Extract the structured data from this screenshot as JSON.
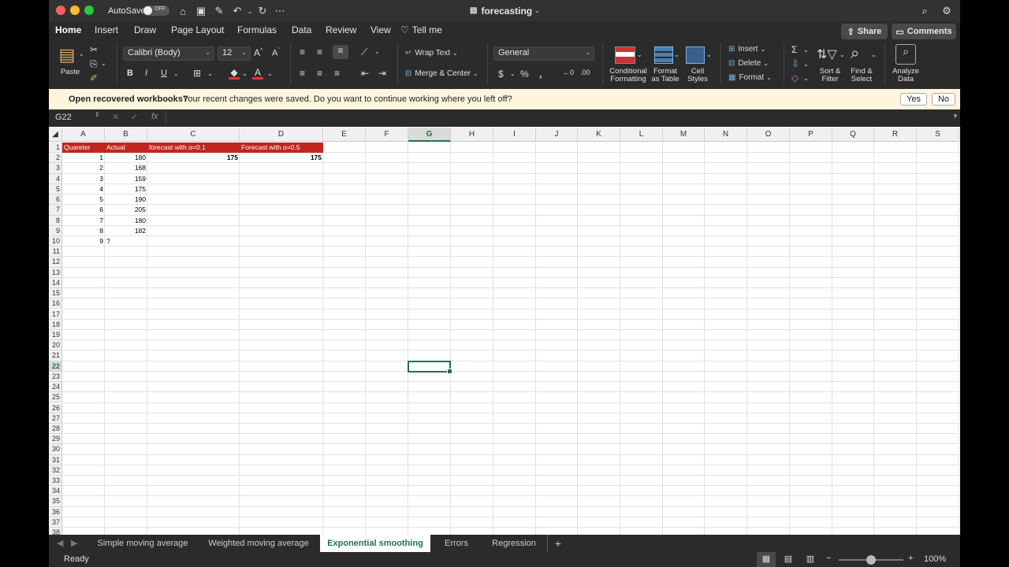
{
  "window": {
    "title": "forecasting",
    "autosave_label": "AutoSave",
    "autosave_state": "OFF"
  },
  "tabs": [
    "Home",
    "Insert",
    "Draw",
    "Page Layout",
    "Formulas",
    "Data",
    "Review",
    "View",
    "Tell me"
  ],
  "share_label": "Share",
  "comments_label": "Comments",
  "ribbon": {
    "paste_label": "Paste",
    "font_name": "Calibri (Body)",
    "font_size": "12",
    "wrap_text": "Wrap Text",
    "merge_center": "Merge & Center",
    "number_format": "General",
    "conditional_formatting": "Conditional\nFormatting",
    "format_as_table": "Format\nas Table",
    "cell_styles": "Cell\nStyles",
    "insert": "Insert",
    "delete": "Delete",
    "format": "Format",
    "sort_filter": "Sort &\nFilter",
    "find_select": "Find &\nSelect",
    "analyze_data": "Analyze\nData"
  },
  "message_bar": {
    "title": "Open recovered workbooks?",
    "text": "Your recent changes were saved. Do you want to continue working where you left off?",
    "yes": "Yes",
    "no": "No"
  },
  "formula_bar": {
    "name_box": "G22",
    "fx": "fx",
    "value": ""
  },
  "columns": [
    "A",
    "B",
    "C",
    "D",
    "E",
    "F",
    "G",
    "H",
    "I",
    "J",
    "K",
    "L",
    "M",
    "N",
    "O",
    "P",
    "Q",
    "R",
    "S"
  ],
  "selected_column": "G",
  "selected_row": 22,
  "row_count": 38,
  "cells": {
    "header": {
      "a": "Quareter",
      "b": "Actual",
      "c": "forecast with α=0.1",
      "d": "Forecast with α=0.5"
    },
    "rows": [
      {
        "a": "1",
        "b": "180",
        "c": "175",
        "d": "175"
      },
      {
        "a": "2",
        "b": "168",
        "c": "",
        "d": ""
      },
      {
        "a": "3",
        "b": "159",
        "c": "",
        "d": ""
      },
      {
        "a": "4",
        "b": "175",
        "c": "",
        "d": ""
      },
      {
        "a": "5",
        "b": "190",
        "c": "",
        "d": ""
      },
      {
        "a": "6",
        "b": "205",
        "c": "",
        "d": ""
      },
      {
        "a": "7",
        "b": "180",
        "c": "",
        "d": ""
      },
      {
        "a": "8",
        "b": "182",
        "c": "",
        "d": ""
      },
      {
        "a": "9",
        "b": "?",
        "c": "",
        "d": ""
      }
    ]
  },
  "sheet_tabs": [
    "Simple moving average",
    "Weighted moving average",
    "Exponential smoothing",
    "Errors",
    "Regression"
  ],
  "active_sheet": "Exponential smoothing",
  "status": {
    "ready": "Ready",
    "zoom": "100%"
  }
}
